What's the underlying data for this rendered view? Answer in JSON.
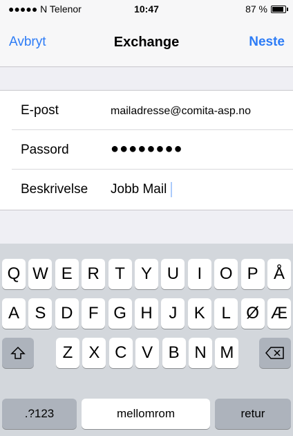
{
  "status": {
    "carrier": "●●●●● N Telenor",
    "time": "10:47",
    "battery": "87 %",
    "battery_level": 0.87
  },
  "navbar": {
    "cancel": "Avbryt",
    "title": "Exchange",
    "next": "Neste"
  },
  "form": {
    "email_label": "E-post",
    "email_value": "mailadresse@comita-asp.no",
    "password_label": "Passord",
    "password_value": "●●●●●●●●",
    "description_label": "Beskrivelse",
    "description_value": "Jobb Mail"
  },
  "keyboard": {
    "row1": [
      "Q",
      "W",
      "E",
      "R",
      "T",
      "Y",
      "U",
      "I",
      "O",
      "P",
      "Å"
    ],
    "row2": [
      "A",
      "S",
      "D",
      "F",
      "G",
      "H",
      "J",
      "K",
      "L",
      "Ø",
      "Æ"
    ],
    "row3": [
      "Z",
      "X",
      "C",
      "V",
      "B",
      "N",
      "M"
    ],
    "numbers": ".?123",
    "space": "mellomrom",
    "return": "retur",
    "shift_icon": "shift-icon",
    "backspace_icon": "backspace-icon"
  }
}
